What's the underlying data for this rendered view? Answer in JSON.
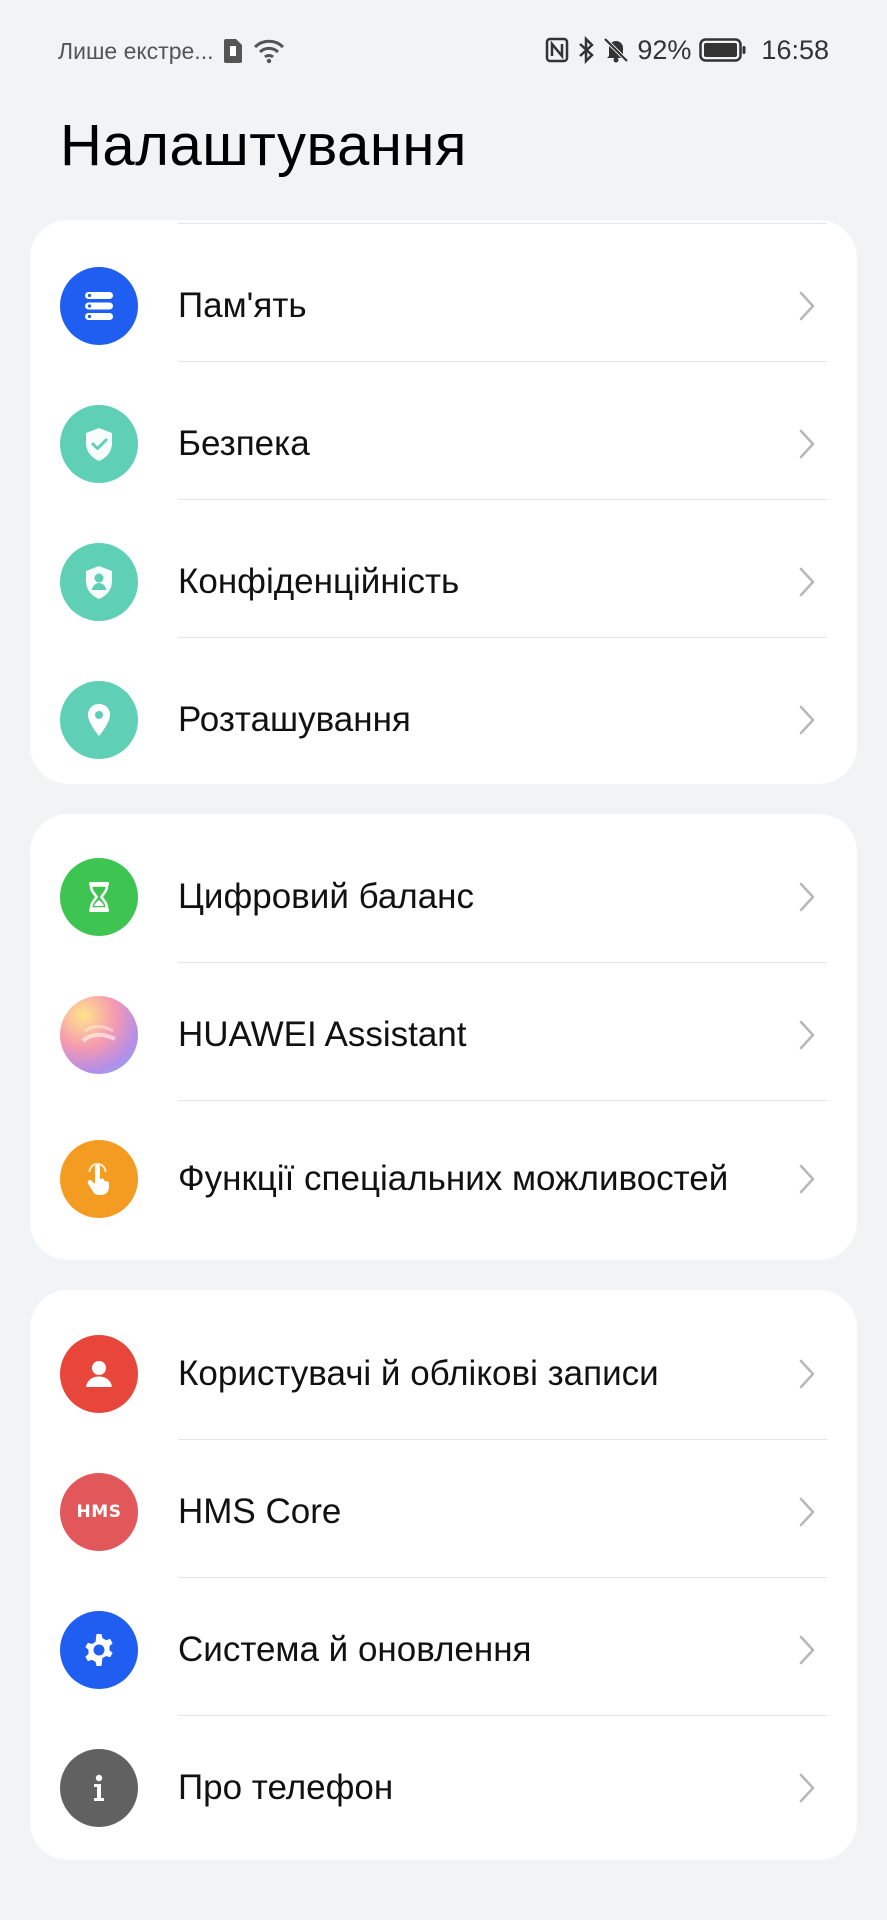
{
  "status_bar": {
    "carrier_text": "Лише екстре...",
    "battery_percent": "92%",
    "time": "16:58"
  },
  "header": {
    "title": "Налаштування"
  },
  "groups": [
    {
      "items": [
        {
          "label": "Пам'ять",
          "icon": "storage-icon",
          "color": "#1f5ef0"
        },
        {
          "label": "Безпека",
          "icon": "shield-check-icon",
          "color": "#5fcfb6"
        },
        {
          "label": "Конфіденційність",
          "icon": "privacy-shield-icon",
          "color": "#5fcfb6"
        },
        {
          "label": "Розташування",
          "icon": "location-pin-icon",
          "color": "#5fcfb6"
        }
      ]
    },
    {
      "items": [
        {
          "label": "Цифровий баланс",
          "icon": "hourglass-icon",
          "color": "#3ec451"
        },
        {
          "label": "HUAWEI Assistant",
          "icon": "assistant-gradient-icon",
          "color": "#e889b8"
        },
        {
          "label": "Функції спеціальних можливостей",
          "icon": "accessibility-hand-icon",
          "color": "#f49c22"
        }
      ]
    },
    {
      "items": [
        {
          "label": "Користувачі й облікові записи",
          "icon": "user-icon",
          "color": "#e9463b"
        },
        {
          "label": "HMS Core",
          "icon": "hms-icon",
          "icon_text": "HMS",
          "color": "#e2585a"
        },
        {
          "label": "Система й оновлення",
          "icon": "gear-icon",
          "color": "#1f5ef0"
        },
        {
          "label": "Про телефон",
          "icon": "info-icon",
          "color": "#616161"
        }
      ]
    }
  ]
}
